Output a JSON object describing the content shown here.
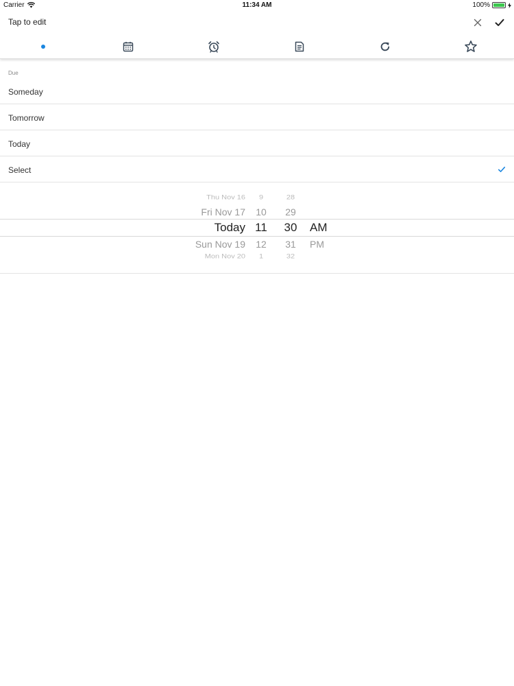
{
  "status_bar": {
    "carrier": "Carrier",
    "time": "11:34 AM",
    "battery": "100%",
    "battery_level": 1.0
  },
  "header": {
    "title": "Tap to edit",
    "close_icon": "close-icon",
    "confirm_icon": "checkmark-icon"
  },
  "toolbar": {
    "items": [
      {
        "icon": "dot-indicator",
        "selected": true
      },
      {
        "icon": "calendar-icon"
      },
      {
        "icon": "alarm-clock-icon"
      },
      {
        "icon": "note-icon"
      },
      {
        "icon": "repeat-icon"
      },
      {
        "icon": "star-icon"
      }
    ],
    "accent": "#1a86e0"
  },
  "due": {
    "label": "Due",
    "options": [
      {
        "label": "Someday",
        "selected": false
      },
      {
        "label": "Tomorrow",
        "selected": false
      },
      {
        "label": "Today",
        "selected": false
      },
      {
        "label": "Select",
        "selected": true
      }
    ]
  },
  "picker": {
    "days": [
      "Thu Nov 16",
      "Fri Nov 17",
      "Today",
      "Sun Nov 19",
      "Mon Nov 20"
    ],
    "hours": [
      "9",
      "10",
      "11",
      "12",
      "1"
    ],
    "minutes": [
      "28",
      "29",
      "30",
      "31",
      "32"
    ],
    "ampm": [
      "AM",
      "PM"
    ]
  }
}
